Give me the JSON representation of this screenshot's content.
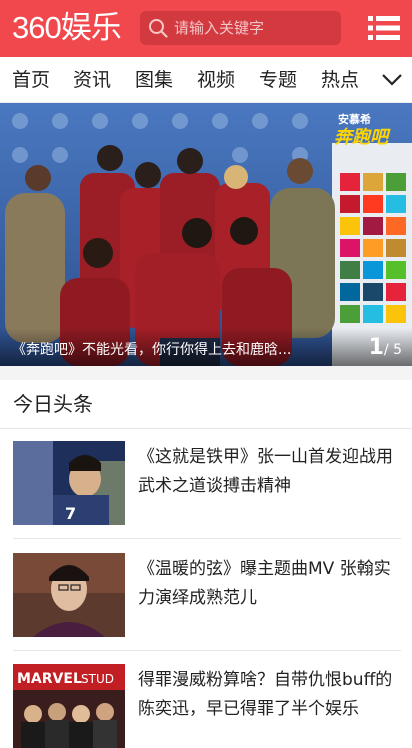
{
  "header": {
    "logo": "360娱乐",
    "search_placeholder": "请输入关键字"
  },
  "nav": {
    "items": [
      "首页",
      "资讯",
      "图集",
      "视频",
      "专题",
      "热点"
    ]
  },
  "banner": {
    "title": "《奔跑吧》不能光看，你行你得上去和鹿晗...",
    "current_page": "1",
    "total_pages": "/ 5",
    "logo_top": "安慕希",
    "logo_main": "奔跑吧"
  },
  "section": {
    "title": "今日头条"
  },
  "news": [
    {
      "title": "《这就是铁甲》张一山首发迎战用武术之道谈搏击精神"
    },
    {
      "title": "《温暖的弦》曝主题曲MV 张翰实力演绎成熟范儿"
    },
    {
      "title": "得罪漫威粉算啥？自带仇恨buff的陈奕迅，早已得罪了半个娱乐"
    }
  ],
  "colors": {
    "brand": "#f0484d",
    "search_bg": "#d23a3f"
  }
}
